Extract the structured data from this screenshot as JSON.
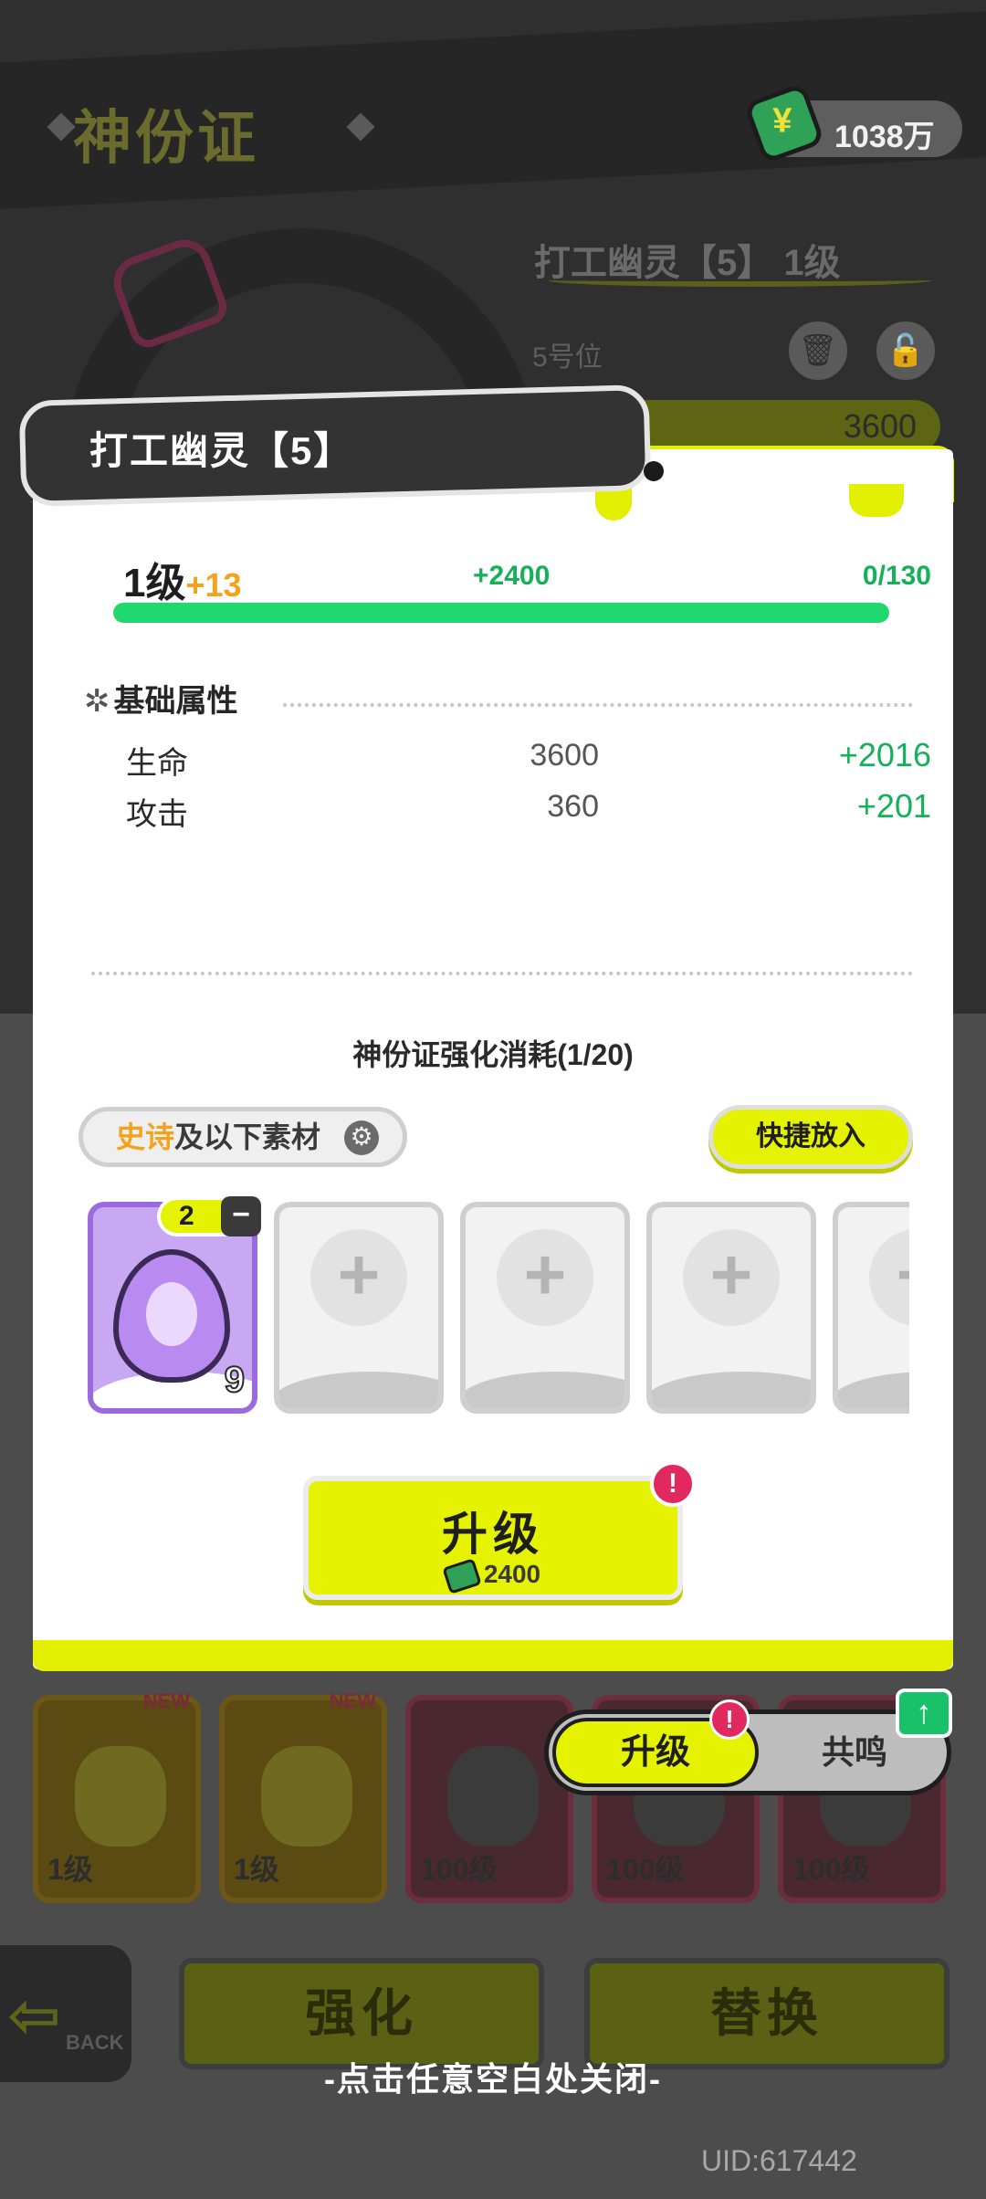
{
  "background": {
    "title": "神份证",
    "character_name": "打工幽灵【5】 1级",
    "slot_label": "5号位",
    "hp_value": "3600",
    "cards": [
      {
        "level": "1级",
        "badge": "NEW"
      },
      {
        "level": "1级",
        "badge": "NEW"
      },
      {
        "level": "100级",
        "badge": ""
      },
      {
        "level": "100级",
        "badge": ""
      },
      {
        "level": "100级",
        "badge": ""
      }
    ],
    "enhance_label": "强化",
    "replace_label": "替换",
    "back_label": "BACK"
  },
  "currency": {
    "amount": "1038万",
    "icon": "cash-icon"
  },
  "modal": {
    "title": "打工幽灵【5】",
    "level": "1级",
    "level_bonus": "+13",
    "xp_gain": "+2400",
    "xp_progress": "0/130",
    "xp_fraction": 1.0,
    "section_title": "基础属性",
    "stats": [
      {
        "name": "生命",
        "value": "3600",
        "bonus": "+2016"
      },
      {
        "name": "攻击",
        "value": "360",
        "bonus": "+201"
      }
    ],
    "cost_title": "神份证强化消耗(1/20)",
    "filter": {
      "epic": "史诗",
      "rest": "及以下素材"
    },
    "quick_add": "快捷放入",
    "material": {
      "selected_qty": "2",
      "owned_count": "9",
      "icon": "purple-flame-icon"
    },
    "upgrade": {
      "label": "升级",
      "cost": "2400",
      "alert": "!"
    }
  },
  "toggle": {
    "active": "升级",
    "inactive": "共鸣",
    "alert": "!",
    "up_icon": "↑"
  },
  "close_hint": "-点击任意空白处关闭-",
  "uid": "UID:617442",
  "colors": {
    "accent": "#e5f200",
    "green": "#16b05a",
    "epic": "#f4a21b",
    "alert": "#e2295f"
  }
}
